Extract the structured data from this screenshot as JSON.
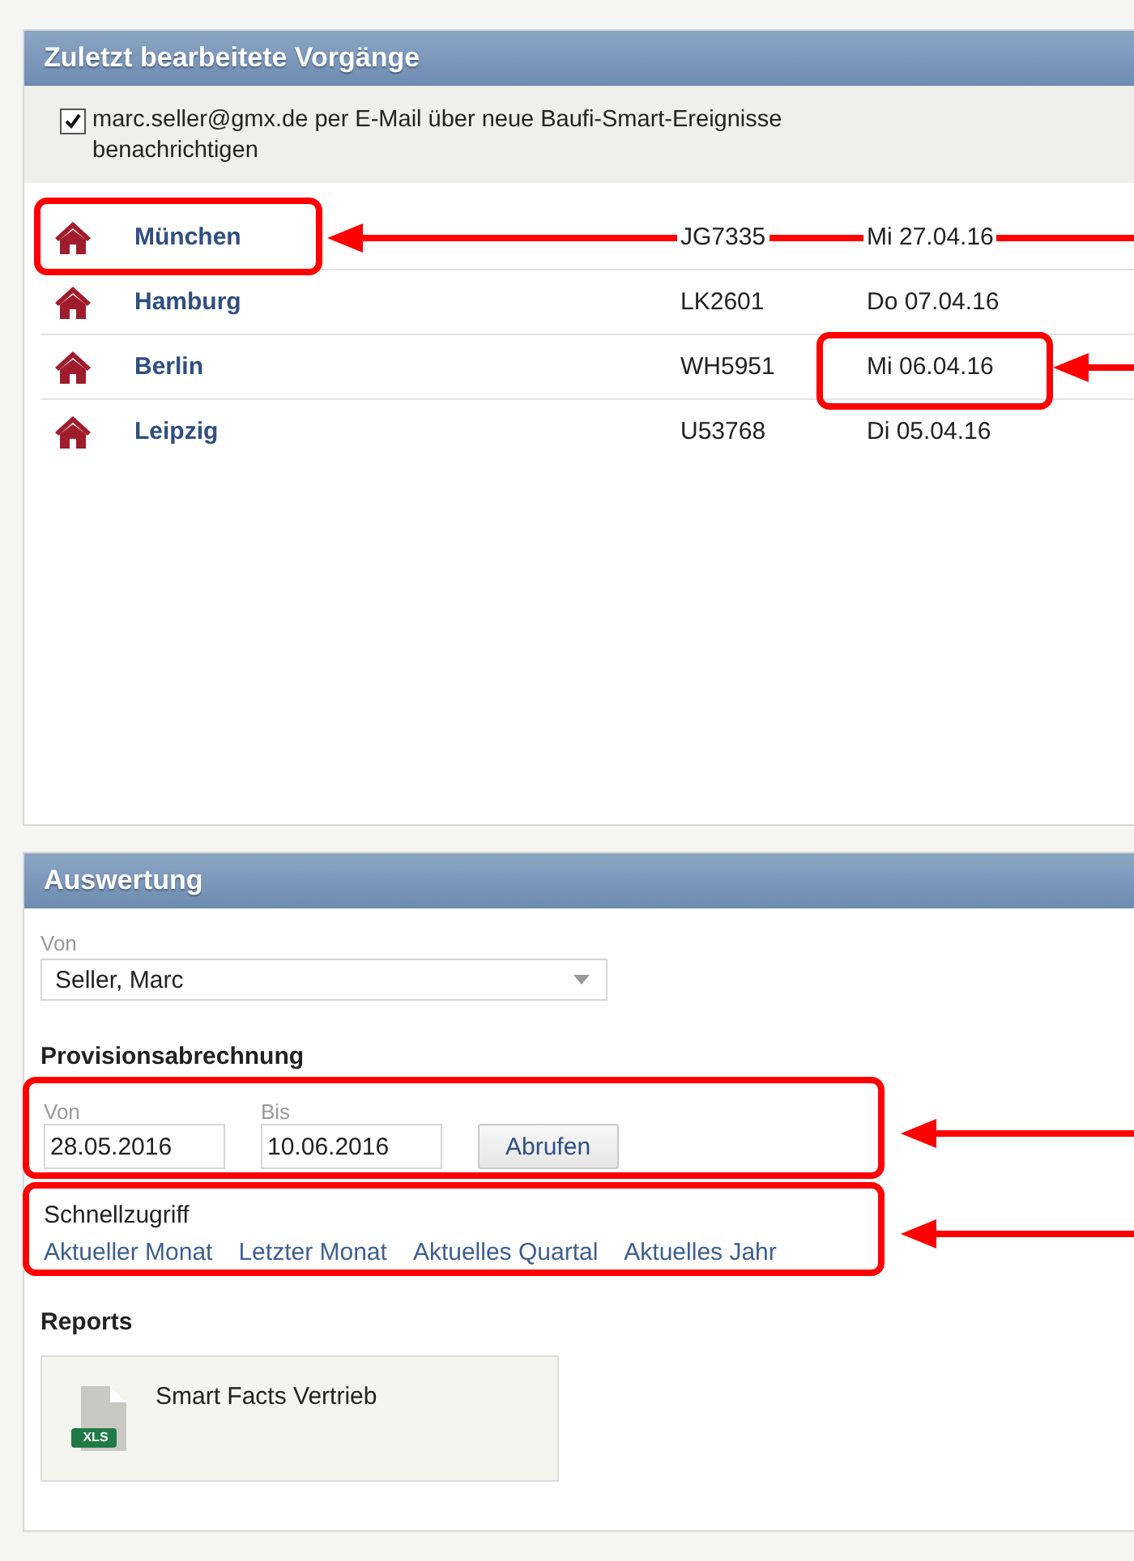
{
  "recent": {
    "title": "Zuletzt bearbeitete Vorgänge",
    "notify": {
      "checked": true,
      "label": "marc.seller@gmx.de per E-Mail über neue Baufi-Smart-Ereignisse benachrichtigen"
    },
    "rows": [
      {
        "name": "München",
        "code": "JG7335",
        "date": "Mi 27.04.16",
        "name_highlighted": true,
        "date_highlighted": false
      },
      {
        "name": "Hamburg",
        "code": "LK2601",
        "date": "Do 07.04.16",
        "name_highlighted": false,
        "date_highlighted": false
      },
      {
        "name": "Berlin",
        "code": "WH5951",
        "date": "Mi 06.04.16",
        "name_highlighted": false,
        "date_highlighted": true
      },
      {
        "name": "Leipzig",
        "code": "U53768",
        "date": "Di 05.04.16",
        "name_highlighted": false,
        "date_highlighted": false
      }
    ]
  },
  "evaluation": {
    "title": "Auswertung",
    "person": {
      "label": "Von",
      "value": "Seller, Marc"
    },
    "commission": {
      "title": "Provisionsabrechnung",
      "callout": true,
      "from": {
        "label": "Von",
        "value": "28.05.2016"
      },
      "to": {
        "label": "Bis",
        "value": "10.06.2016"
      },
      "button": "Abrufen"
    },
    "quick": {
      "title": "Schnellzugriff",
      "callout": true,
      "links": [
        "Aktueller Monat",
        "Letzter Monat",
        "Aktuelles Quartal",
        "Aktuelles Jahr"
      ]
    },
    "reports": {
      "title": "Reports",
      "items": [
        {
          "name": "Smart Facts Vertrieb",
          "file_type": "XLS"
        }
      ]
    }
  }
}
